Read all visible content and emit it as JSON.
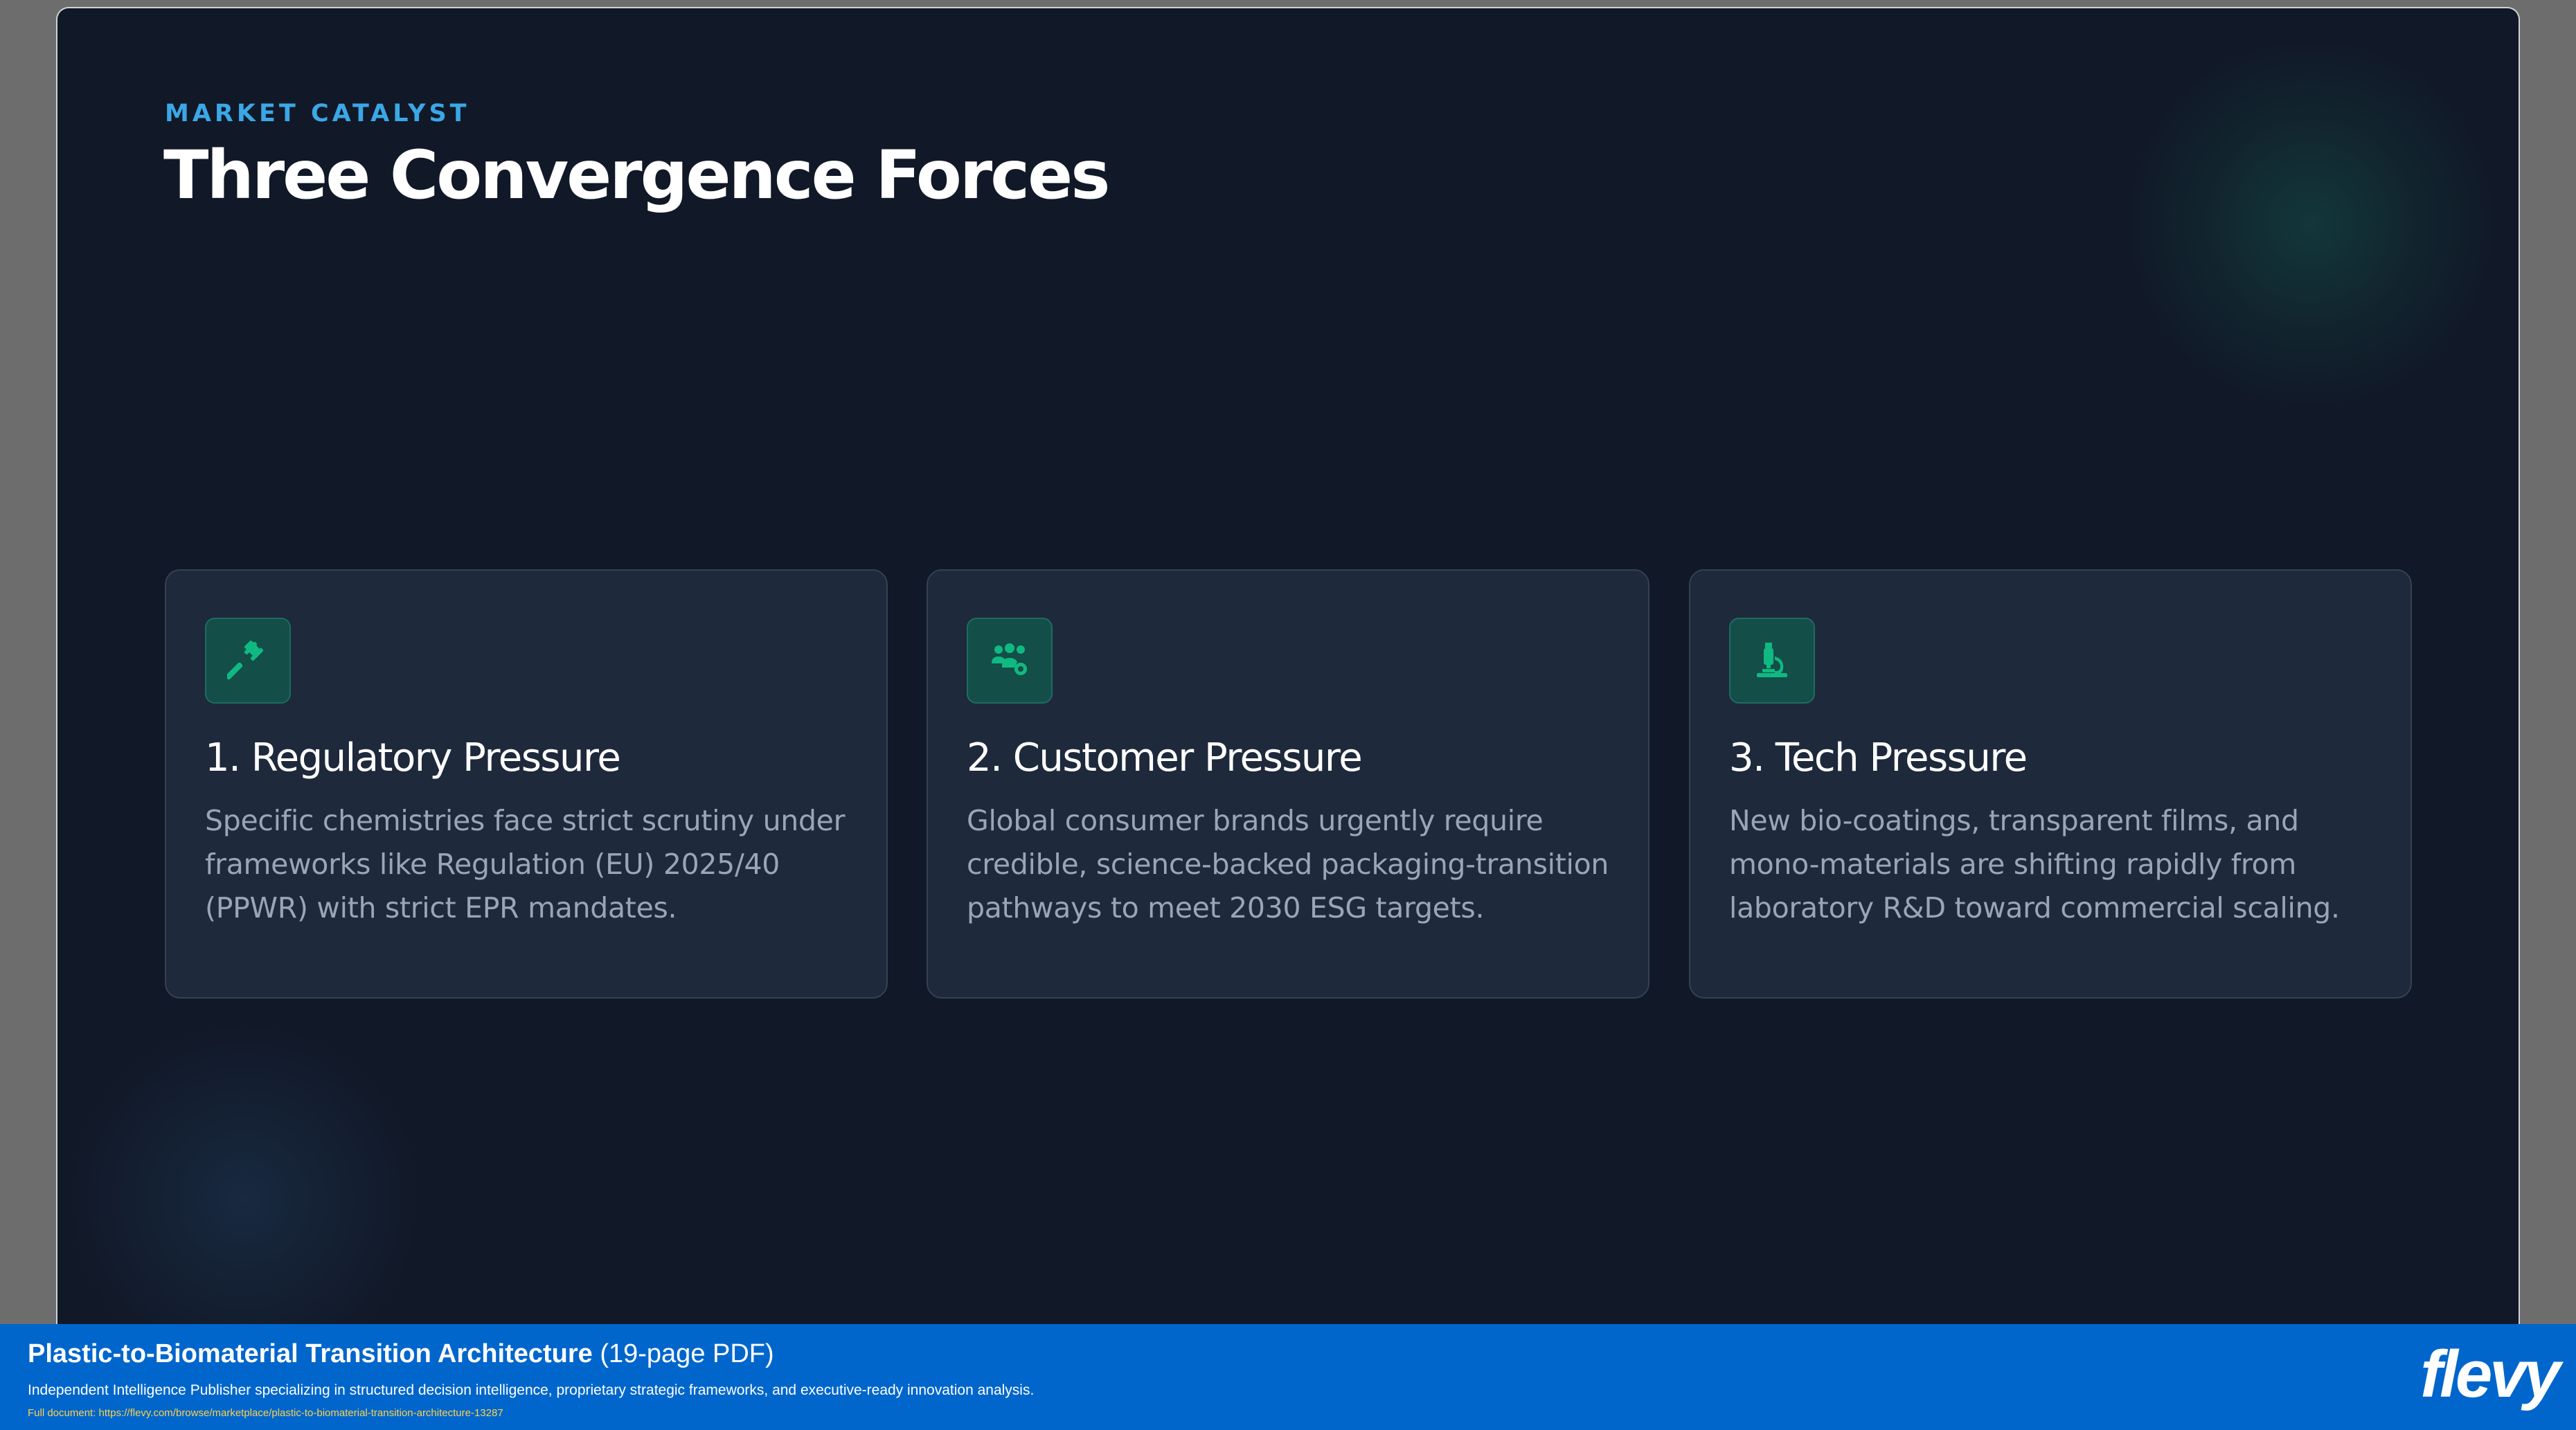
{
  "slide": {
    "kicker": "MARKET CATALYST",
    "title": "Three Convergence Forces",
    "cards": [
      {
        "icon": "gavel-icon",
        "title": "1. Regulatory Pressure",
        "body": "Specific chemistries face strict scrutiny under frameworks like Regulation (EU) 2025/40 (PPWR) with strict EPR mandates."
      },
      {
        "icon": "users-cog-icon",
        "title": "2. Customer Pressure",
        "body": "Global consumer brands urgently require credible, science-backed packaging-transition pathways to meet 2030 ESG targets."
      },
      {
        "icon": "microscope-icon",
        "title": "3. Tech Pressure",
        "body": "New bio-coatings, transparent films, and mono-materials are shifting rapidly from laboratory R&D toward commercial scaling."
      }
    ]
  },
  "footer": {
    "title": "Plastic-to-Biomaterial Transition Architecture",
    "pages": " (19-page PDF)",
    "description": "Independent Intelligence Publisher specializing in structured decision intelligence, proprietary strategic frameworks, and executive-ready innovation analysis.",
    "url_label": "Full document: ",
    "url": "https://flevy.com/browse/marketplace/plastic-to-biomaterial-transition-architecture-13287",
    "logo": "flevy"
  },
  "colors": {
    "slide_bg": "#111827",
    "card_bg": "#1e293b",
    "accent_blue": "#3ba7e6",
    "accent_teal": "#10b981",
    "footer_bg": "#0066cc"
  }
}
